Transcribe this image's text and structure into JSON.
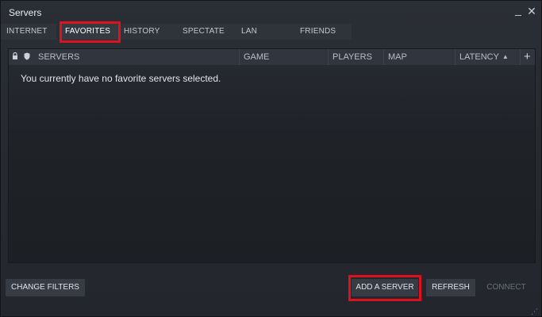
{
  "window": {
    "title": "Servers",
    "minimize_glyph": "_",
    "close_glyph": "✕"
  },
  "tabs": [
    {
      "label": "INTERNET"
    },
    {
      "label": "FAVORITES",
      "active": true
    },
    {
      "label": "HISTORY"
    },
    {
      "label": "SPECTATE"
    },
    {
      "label": "LAN"
    },
    {
      "label": "FRIENDS"
    }
  ],
  "table": {
    "columns": {
      "lock_icon": "lock-icon",
      "shield_icon": "shield-icon",
      "servers": "SERVERS",
      "game": "GAME",
      "players": "PLAYERS",
      "map": "MAP",
      "latency": "LATENCY",
      "add": "+"
    },
    "sort_indicator": "▲",
    "empty_message": "You currently have no favorite servers selected."
  },
  "buttons": {
    "change_filters": "CHANGE FILTERS",
    "add_server": "ADD A SERVER",
    "refresh": "REFRESH",
    "connect": "CONNECT"
  },
  "colors": {
    "highlight": "#e0101c",
    "background": "#23262c",
    "panel": "#1f2227"
  }
}
